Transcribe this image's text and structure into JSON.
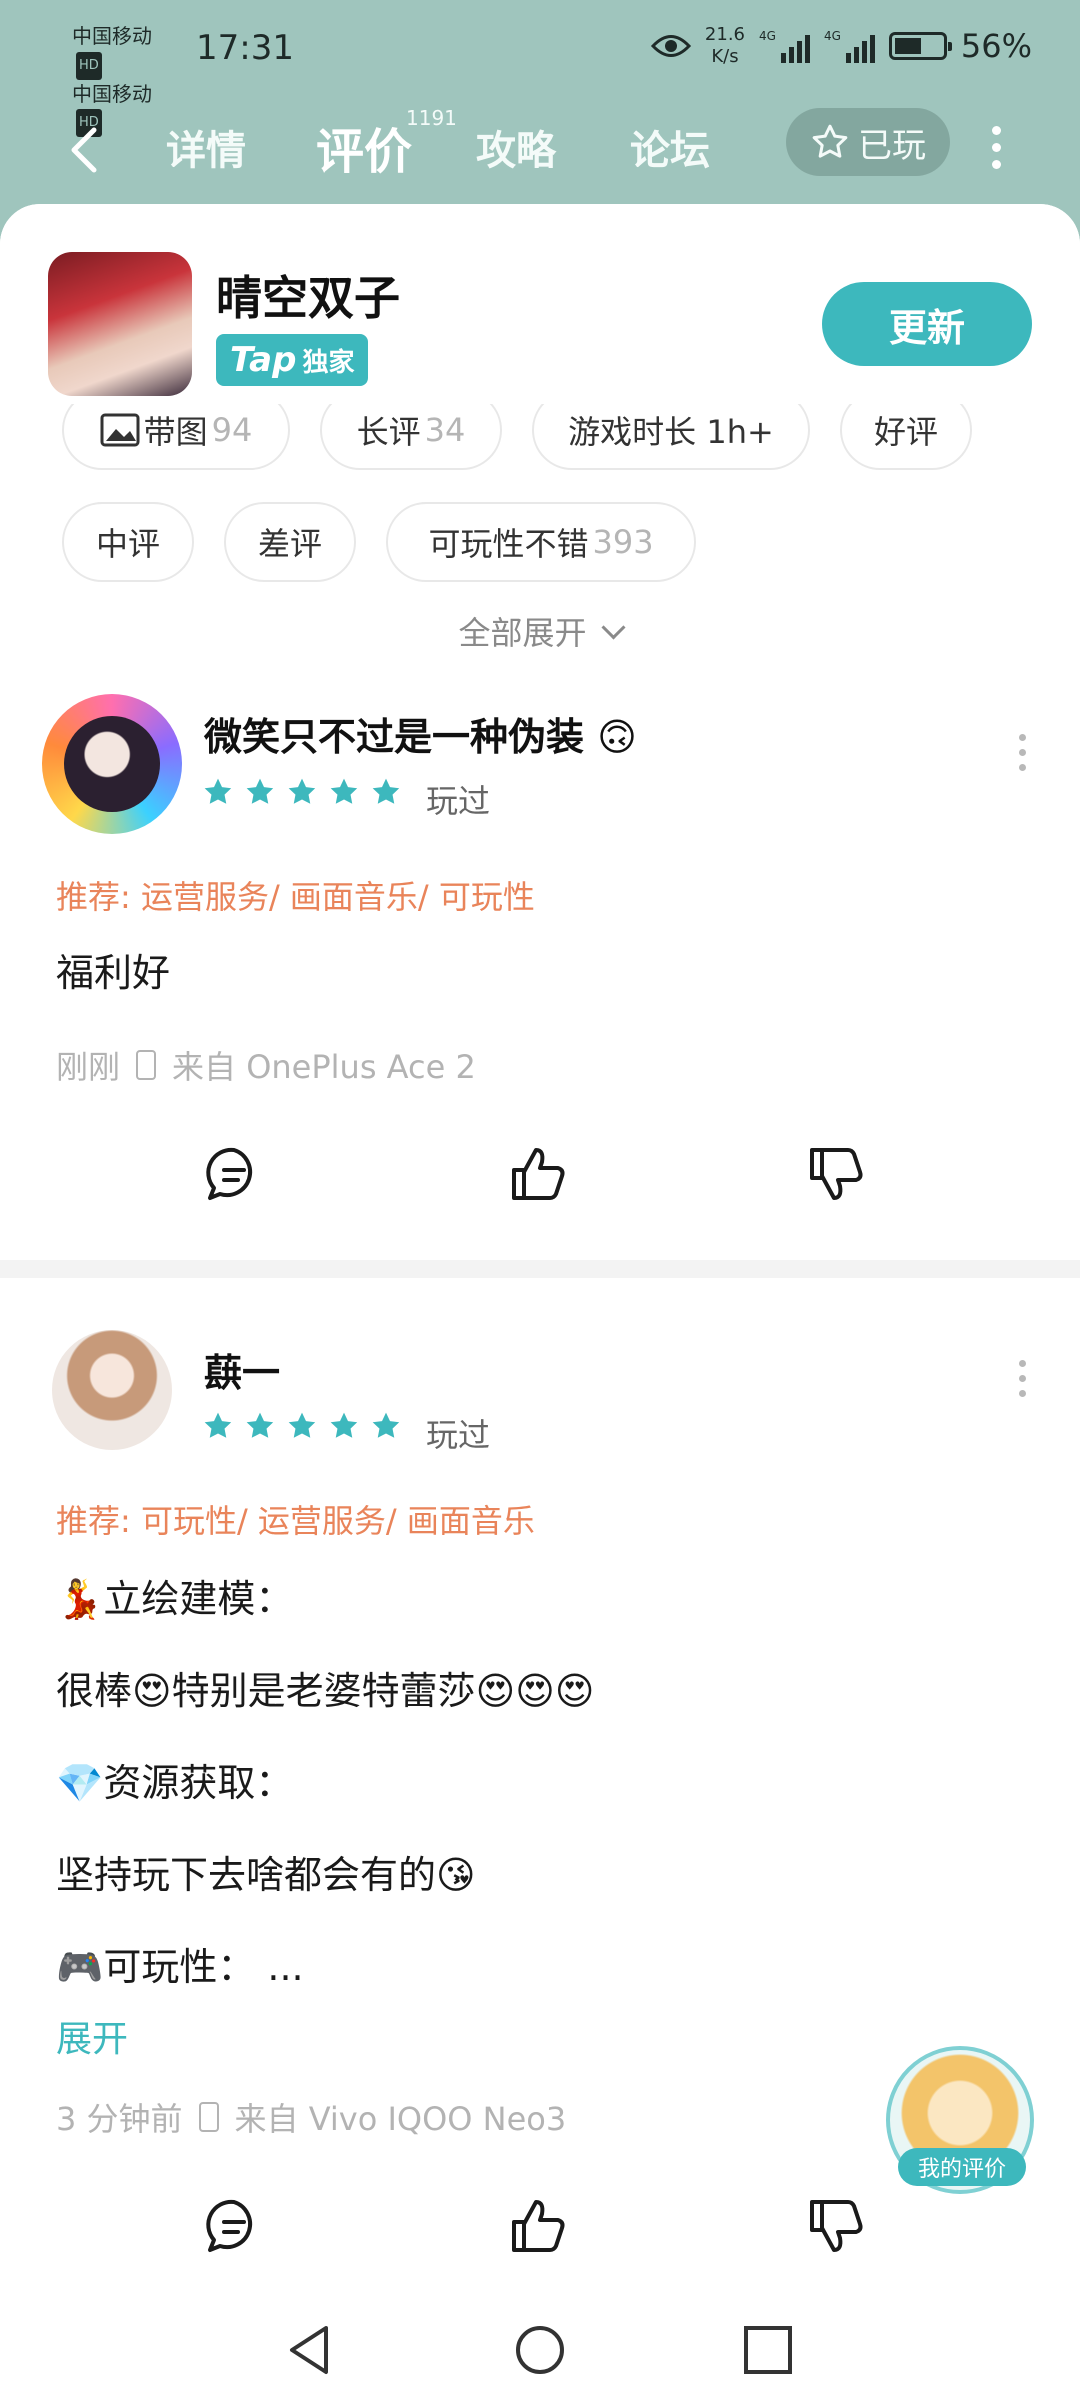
{
  "status_bar": {
    "carrier_1": "中国移动",
    "carrier_2": "中国移动",
    "hd_tag": "HD",
    "time": "17:31",
    "net_speed_value": "21.6",
    "net_speed_unit": "K/s",
    "signal_tag": "4G",
    "battery_percent": "56%",
    "battery_level": 0.56
  },
  "nav": {
    "tabs": [
      {
        "label": "详情",
        "active": false
      },
      {
        "label": "评价",
        "active": true
      },
      {
        "label": "攻略",
        "active": false
      },
      {
        "label": "论坛",
        "active": false
      }
    ],
    "review_count": "1191",
    "played_label": "已玩"
  },
  "game": {
    "title": "晴空双子",
    "badge_tap": "Tap",
    "badge_exclusive": "独家",
    "update_label": "更新"
  },
  "filters": [
    {
      "label": "带图",
      "count": "94"
    },
    {
      "label": "长评",
      "count": "34"
    },
    {
      "label": "游戏时长 1h+",
      "count": ""
    },
    {
      "label": "好评",
      "count": ""
    },
    {
      "label": "中评",
      "count": ""
    },
    {
      "label": "差评",
      "count": ""
    },
    {
      "label": "可玩性不错",
      "count": "393"
    }
  ],
  "expand_all_label": "全部展开",
  "reviews": [
    {
      "username": "微笑只不过是一种伪装 🙃",
      "rating": 5,
      "played": "玩过",
      "recommend": "推荐: 运营服务/ 画面音乐/ 可玩性",
      "lines": [
        "福利好"
      ],
      "time": "刚刚",
      "device": "来自 OnePlus Ace 2"
    },
    {
      "username": "蕻一",
      "rating": 5,
      "played": "玩过",
      "recommend": "推荐: 可玩性/ 运营服务/ 画面音乐",
      "lines": [
        "💃立绘建模：",
        "很棒😍特别是老婆特蕾莎😍😍😍",
        "💎资源获取：",
        "坚持玩下去啥都会有的😘",
        "🎮可玩性：  ..."
      ],
      "expand_label": "展开",
      "time": "3 分钟前",
      "device": "来自 Vivo IQOO Neo3"
    }
  ],
  "my_review_label": "我的评价",
  "colors": {
    "header_bg": "#9fc5bd",
    "accent": "#3db8bd",
    "recommend": "#e9845a",
    "muted": "#b3b3b3"
  },
  "icons": [
    "back-icon",
    "eye-icon",
    "signal-icon",
    "battery-icon",
    "star-outline-icon",
    "more-vert-icon",
    "image-icon",
    "chevron-down-icon",
    "star-icon",
    "comment-icon",
    "thumbs-up-icon",
    "thumbs-down-icon",
    "phone-icon",
    "nav-back-icon",
    "nav-home-icon",
    "nav-recents-icon"
  ]
}
